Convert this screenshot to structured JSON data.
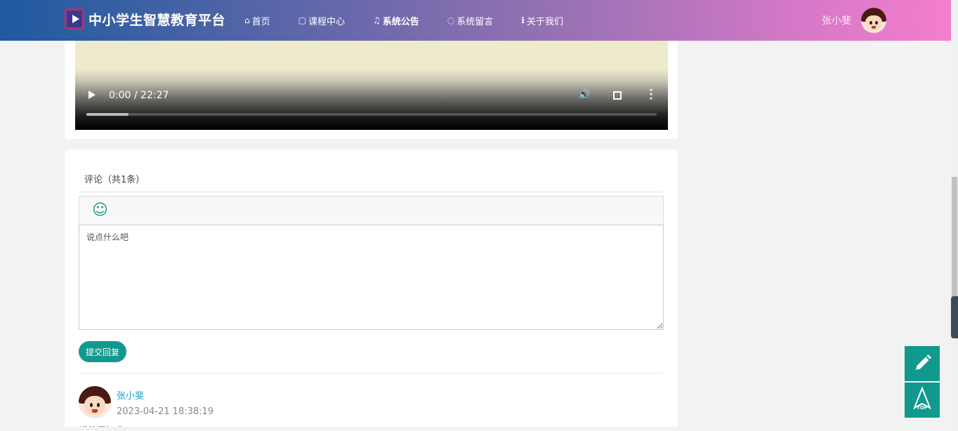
{
  "header": {
    "logo_text": "中小学生智慧教育平台",
    "nav": [
      {
        "label": "首页",
        "icon": "home-icon",
        "glyph": "⌂"
      },
      {
        "label": "课程中心",
        "icon": "book-icon",
        "glyph": "▢"
      },
      {
        "label": "系统公告",
        "icon": "bell-icon",
        "glyph": "🔔"
      },
      {
        "label": "系统留言",
        "icon": "chat-icon",
        "glyph": "💬"
      },
      {
        "label": "关于我们",
        "icon": "info-icon",
        "glyph": "ℹ"
      }
    ],
    "active_nav": "系统公告",
    "user_name": "张小斐"
  },
  "video": {
    "time": "0:00 / 22:27",
    "progress_buffered": 0.074
  },
  "comments": {
    "title": "评论（共1条）",
    "placeholder": "说点什么吧",
    "submit_label": "提交回复",
    "items": [
      {
        "user": "张小斐",
        "time": "2023-04-21 18:38:19",
        "text": "讲的很好😊"
      }
    ]
  },
  "floating": {
    "top_label": "TOP"
  },
  "colors": {
    "accent": "#11998e",
    "link": "#1a9bc6",
    "header_start": "#1f5aa0",
    "header_end": "#f47fce"
  }
}
